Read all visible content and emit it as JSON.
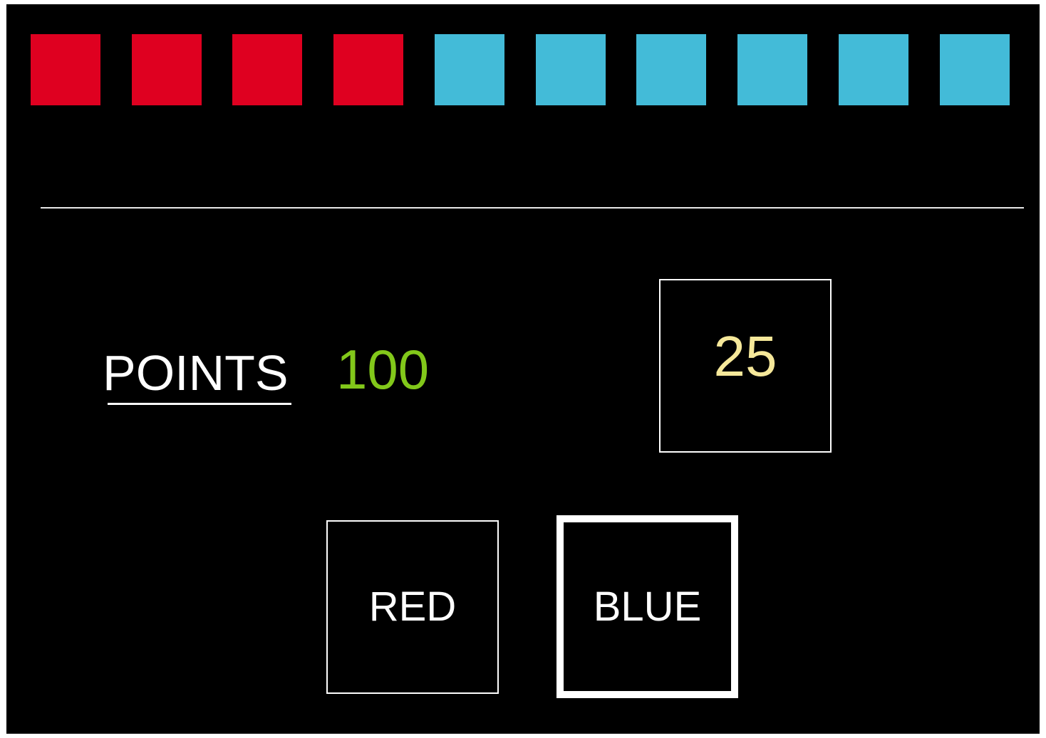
{
  "tiles": [
    {
      "color": "#df0020"
    },
    {
      "color": "#df0020"
    },
    {
      "color": "#df0020"
    },
    {
      "color": "#df0020"
    },
    {
      "color": "#43bbd8"
    },
    {
      "color": "#43bbd8"
    },
    {
      "color": "#43bbd8"
    },
    {
      "color": "#43bbd8"
    },
    {
      "color": "#43bbd8"
    },
    {
      "color": "#43bbd8"
    }
  ],
  "score": {
    "label": "POINTS",
    "value": "100"
  },
  "counter": {
    "value": "25"
  },
  "choices": {
    "red_label": "RED",
    "blue_label": "BLUE",
    "selected": "blue"
  },
  "colors": {
    "background": "#000000",
    "red_tile": "#df0020",
    "blue_tile": "#43bbd8",
    "points_value": "#82c81a",
    "counter_value": "#f6e89a"
  }
}
